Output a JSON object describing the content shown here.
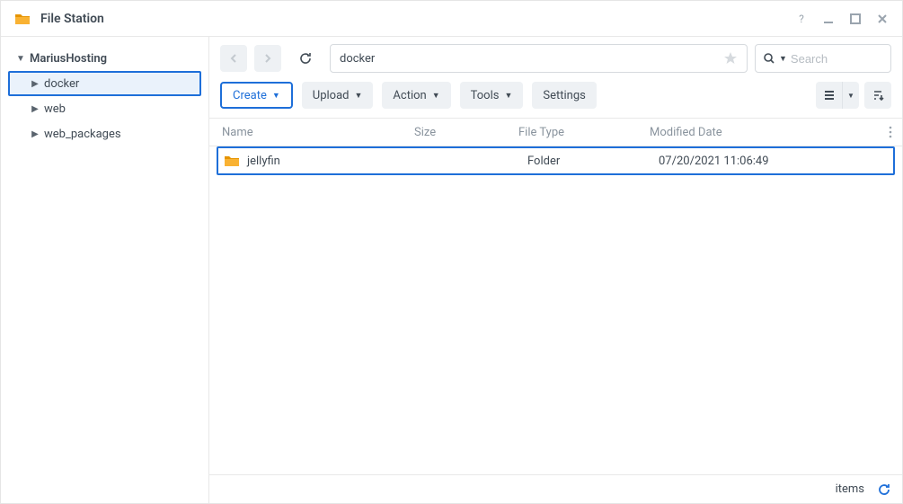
{
  "app": {
    "title": "File Station"
  },
  "sidebar": {
    "root": "MariusHosting",
    "items": [
      {
        "label": "docker",
        "selected": true
      },
      {
        "label": "web",
        "selected": false
      },
      {
        "label": "web_packages",
        "selected": false
      }
    ]
  },
  "toolbar": {
    "path": "docker",
    "search_placeholder": "Search",
    "create": "Create",
    "upload": "Upload",
    "action": "Action",
    "tools": "Tools",
    "settings": "Settings"
  },
  "columns": {
    "name": "Name",
    "size": "Size",
    "type": "File Type",
    "date": "Modified Date"
  },
  "rows": [
    {
      "name": "jellyfin",
      "size": "",
      "type": "Folder",
      "date": "07/20/2021 11:06:49"
    }
  ],
  "status": {
    "items_label": "items"
  }
}
